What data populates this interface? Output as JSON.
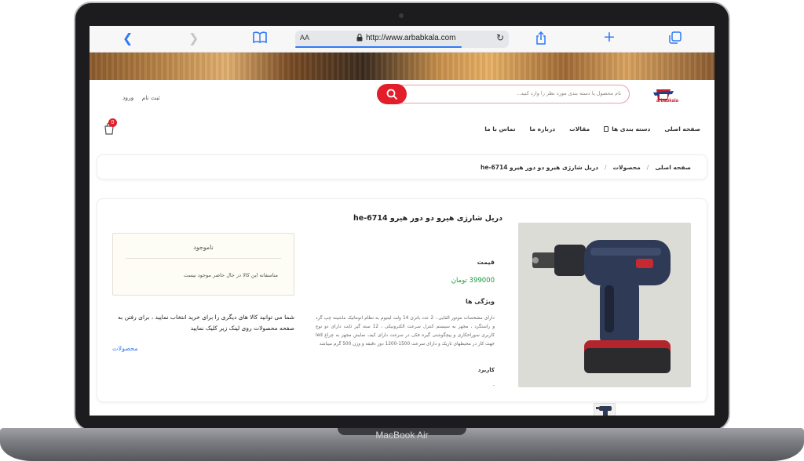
{
  "device": {
    "label": "MacBook Air"
  },
  "browser": {
    "aa_label": "AA",
    "url": "http://www.arbabkala.com",
    "icons": [
      "chevron-left-icon",
      "chevron-right-icon",
      "book-icon",
      "lock-icon",
      "reload-icon",
      "share-icon",
      "plus-icon",
      "tabs-icon"
    ]
  },
  "site": {
    "logo_text": "arbabkala",
    "search_placeholder": "نام محصول یا دسته بندی مورد نظر را وارد کنید...",
    "auth": {
      "login": "ورود",
      "register": "ثبت نام"
    },
    "nav": [
      "صفحه اصلی",
      "دسته بندی ها",
      "مقالات",
      "درباره ما",
      "تماس با ما"
    ],
    "cart_count": "0",
    "accent": "#e21e2a"
  },
  "breadcrumb": [
    "صفحه اصلی",
    "محصولات",
    "دریل شارژی هیرو دو دور هیرو he-6714"
  ],
  "product": {
    "title": "دریل شارژی هیرو دو دور هیرو he-6714",
    "price_label": "قیمت",
    "price": "399000 تومان",
    "features_label": "ویژگی ها",
    "description": "دارای مشخصات موتور القایی ، 2 عدد باتری 14 ولت لیتیوم به نظام اتوماتیک ماشینه چپ گرد و راستگرد ، مجهز به سیستم کنترل سرعت الکترونیکی ، 12 سته گیر ثابت دارای دو نوع کاربری سوراخکاری و پیچگوشتی گیره فکی در سرعت دارای کیف نمایش مجهز به چراغ led جهت کار در محیطهای تاریک و دارای سرعت 1500-1200 دور دقیقه و وزن 500 گرم میباشد",
    "usage_label": "کاربرد",
    "usage_value": "-",
    "stock_title": "ناموجود",
    "stock_message": "متاسفانه این کالا در حال حاضر موجود نیست",
    "suggestion": "شما می توانید کالا های دیگری را برای خرید انتخاب نمایید ، برای رفتن به صفحه محصولات روی لینک زیر کلیک نمایید",
    "products_link": "محصولات"
  }
}
